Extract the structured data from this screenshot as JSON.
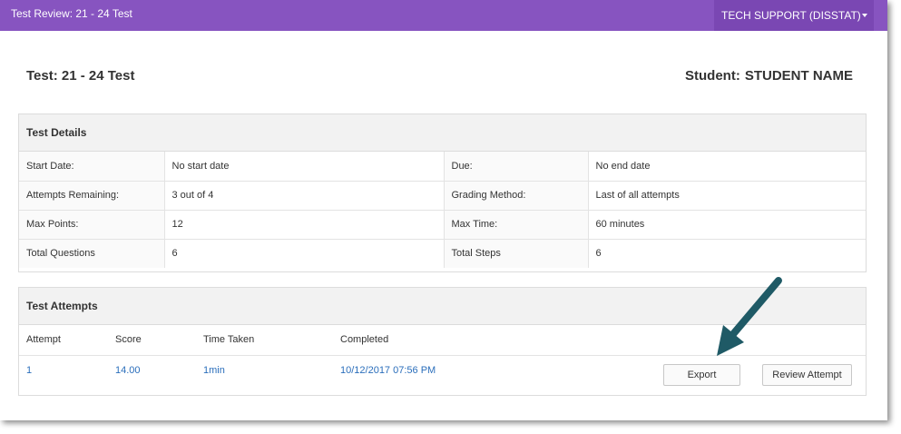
{
  "topbar": {
    "title": "Test Review: 21 - 24 Test",
    "user": "TECH SUPPORT (DISSTAT)"
  },
  "header": {
    "test_title": "Test: 21 - 24 Test",
    "student_label": "Student:",
    "student_name": "STUDENT NAME"
  },
  "details": {
    "title": "Test Details",
    "rows": [
      [
        "Start Date:",
        "No start date",
        "Due:",
        "No end date"
      ],
      [
        "Attempts Remaining:",
        "3 out of 4",
        "Grading Method:",
        "Last of all attempts"
      ],
      [
        "Max Points:",
        "12",
        "Max Time:",
        "60 minutes"
      ],
      [
        "Total Questions",
        "6",
        "Total Steps",
        "6"
      ]
    ]
  },
  "attempts": {
    "title": "Test Attempts",
    "headers": [
      "Attempt",
      "Score",
      "Time Taken",
      "Completed"
    ],
    "rows": [
      {
        "attempt": "1",
        "score": "14.00",
        "time": "1min",
        "completed": "10/12/2017 07:56 PM"
      }
    ],
    "export_label": "Export",
    "review_label": "Review Attempt"
  },
  "colors": {
    "topbar": "#8754c0",
    "link": "#2a6ebb",
    "arrow": "#1f5a66"
  },
  "icons": [
    "caret-down-icon",
    "annotation-arrow"
  ]
}
